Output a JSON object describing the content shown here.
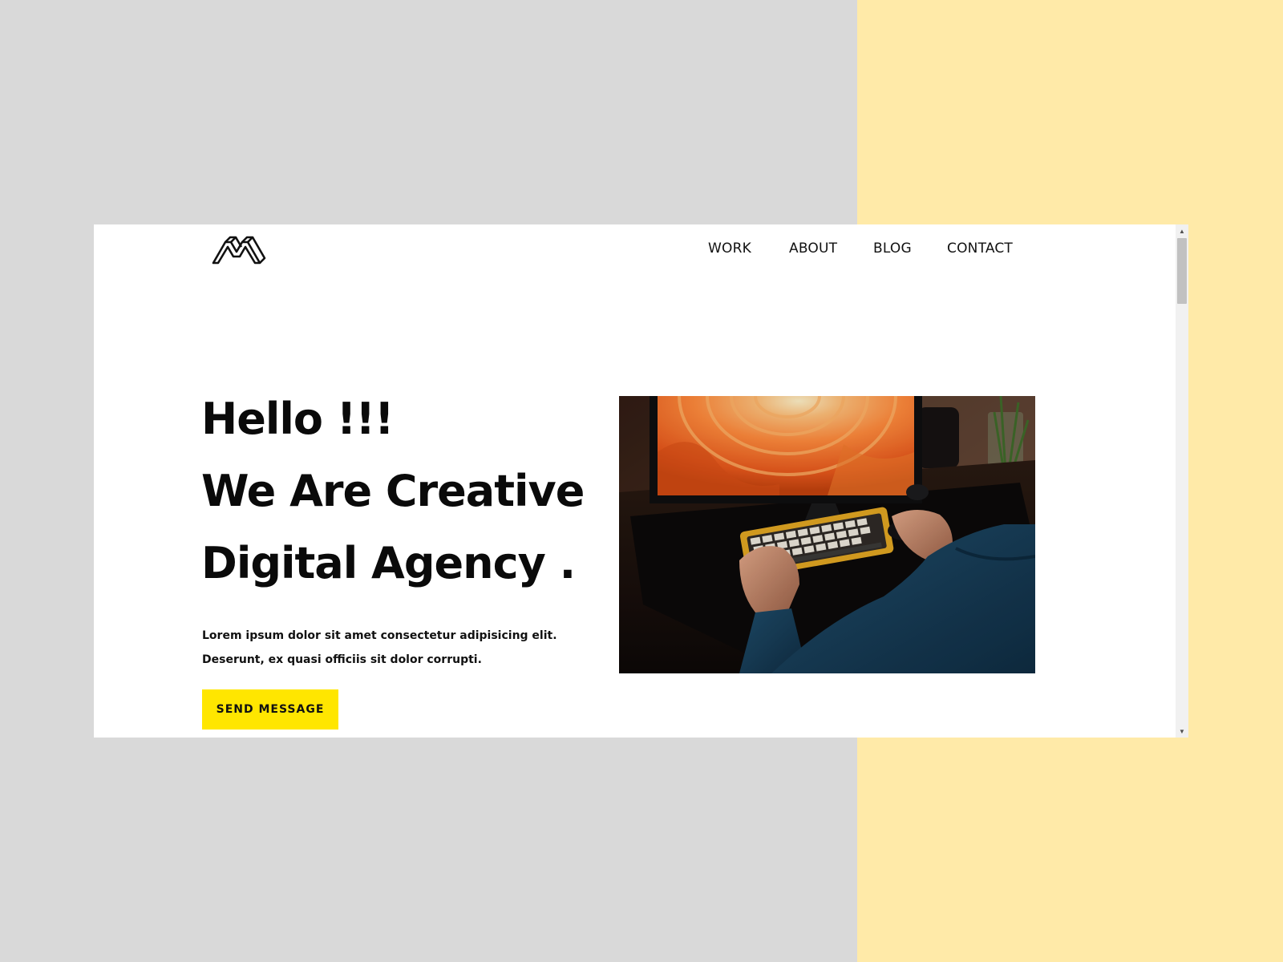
{
  "colors": {
    "backdrop_left": "#d9d9d9",
    "backdrop_right": "#ffeaa8",
    "accent_button": "#ffe600",
    "text": "#0a0a0a"
  },
  "logo": {
    "icon": "brand-logo-icon"
  },
  "nav": {
    "items": [
      {
        "label": "WORK"
      },
      {
        "label": "ABOUT"
      },
      {
        "label": "BLOG"
      },
      {
        "label": "CONTACT"
      }
    ]
  },
  "hero": {
    "headline": [
      "Hello !!!",
      "We Are Creative",
      "Digital Agency ."
    ],
    "description": "Lorem ipsum dolor sit amet consectetur adipisicing elit. Deserunt, ex quasi officiis sit dolor corrupti.",
    "button_label": "SEND MESSAGE",
    "image": "person typing on mechanical keyboard at desk with monitor showing orange abstract wallpaper"
  },
  "scrollbar": {
    "up_icon": "scroll-up-arrow-icon",
    "down_icon": "scroll-down-arrow-icon"
  }
}
